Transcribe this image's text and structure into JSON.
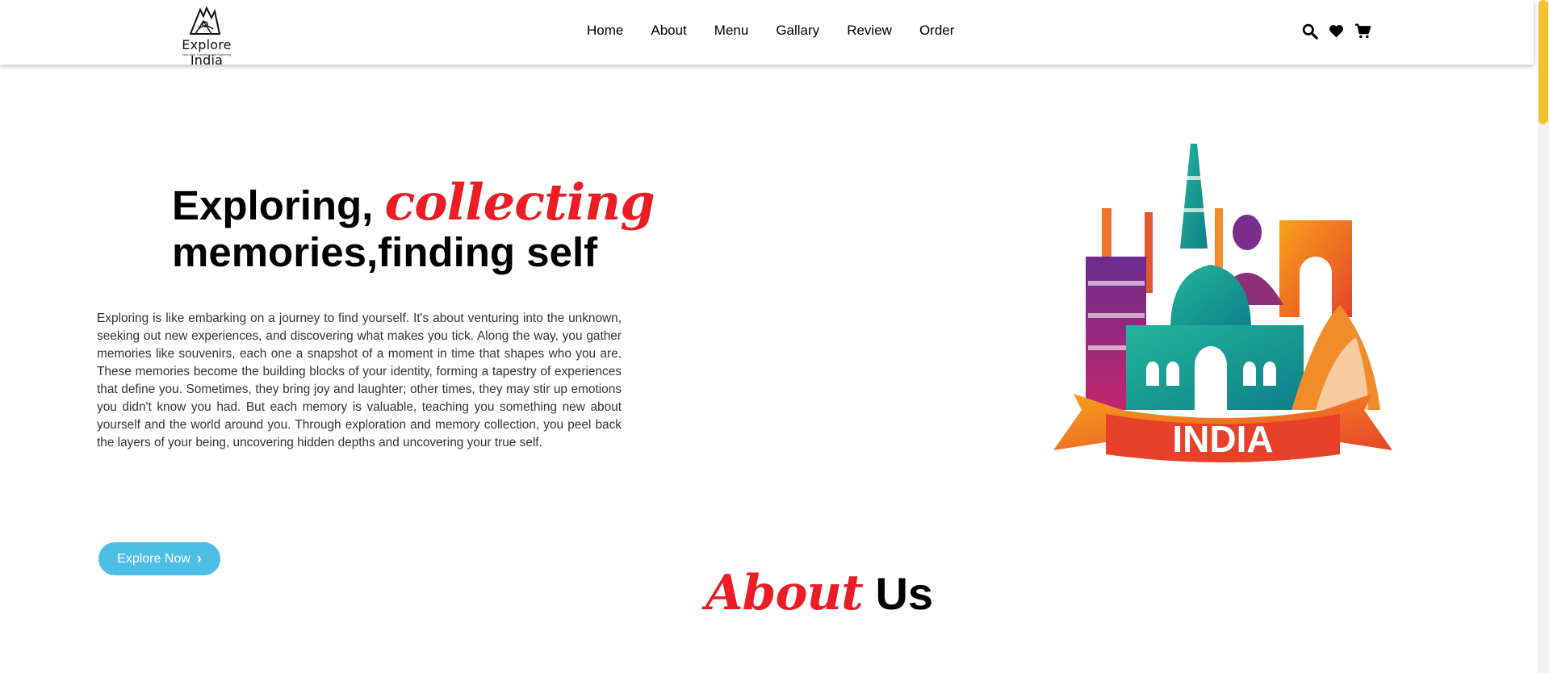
{
  "header": {
    "logo": {
      "title": "Explore India",
      "tagline": "Non-stop Travelling and Exploring"
    },
    "nav": [
      "Home",
      "About",
      "Menu",
      "Gallary",
      "Review",
      "Order"
    ],
    "icons": [
      "search-icon",
      "heart-icon",
      "cart-icon"
    ]
  },
  "hero": {
    "title_part1": "Exploring, ",
    "title_accent": "collecting",
    "title_part2": "memories,finding self",
    "body": "Exploring is like embarking on a journey to find yourself. It's about venturing into the unknown, seeking out new experiences, and discovering what makes you tick. Along the way, you gather memories like souvenirs, each one a snapshot of a moment in time that shapes who you are. These memories become the building blocks of your identity, forming a tapestry of experiences that define you. Sometimes, they bring joy and laughter; other times, they may stir up emotions you didn't know you had. But each memory is valuable, teaching you something new about yourself and the world around you. Through exploration and memory collection, you peel back the layers of your being, uncovering hidden depths and uncovering your true self.",
    "button_label": "Explore Now",
    "illustration_label": "INDIA"
  },
  "about": {
    "accent": "About",
    "rest": "Us"
  },
  "colors": {
    "accent_red": "#ec1c24",
    "button_blue": "#4dbfe4",
    "scroll_yellow": "#f5c12e"
  }
}
